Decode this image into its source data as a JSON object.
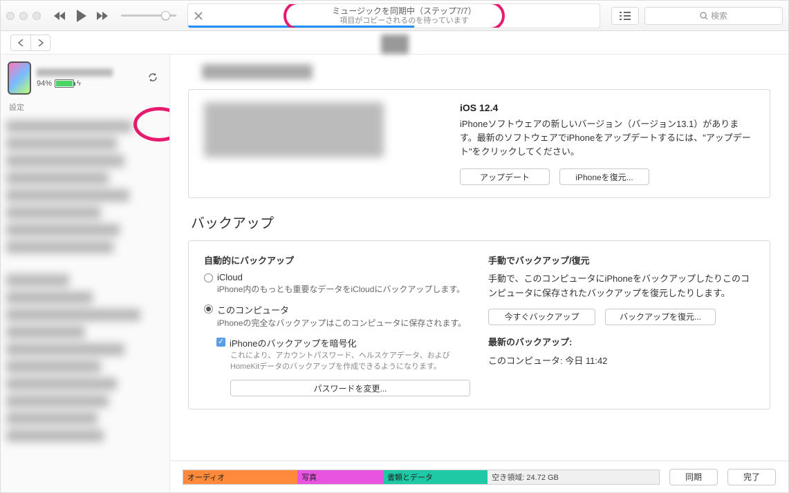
{
  "titlebar": {
    "status_line1": "ミュージックを同期中（ステップ7/7）",
    "status_line2": "項目がコピーされるのを待っています",
    "search_placeholder": "検索"
  },
  "sidebar": {
    "battery_pct": "94%",
    "settings_header": "設定"
  },
  "ios": {
    "heading": "iOS 12.4",
    "body": "iPhoneソフトウェアの新しいバージョン（バージョン13.1）があります。最新のソフトウェアでiPhoneをアップデートするには、\"アップデート\"をクリックしてください。",
    "update_btn": "アップデート",
    "restore_btn": "iPhoneを復元..."
  },
  "backup": {
    "section_title": "バックアップ",
    "auto_hdr": "自動的にバックアップ",
    "opt_icloud": "iCloud",
    "opt_icloud_desc": "iPhone内のもっとも重要なデータをiCloudにバックアップします。",
    "opt_computer": "このコンピュータ",
    "opt_computer_desc": "iPhoneの完全なバックアップはこのコンピュータに保存されます。",
    "encrypt_label": "iPhoneのバックアップを暗号化",
    "encrypt_desc": "これにより、アカウントパスワード、ヘルスケアデータ、およびHomeKitデータのバックアップを作成できるようになります。",
    "change_pw_btn": "パスワードを変更...",
    "manual_hdr": "手動でバックアップ/復元",
    "manual_desc": "手動で、このコンピュータにiPhoneをバックアップしたりこのコンピュータに保存されたバックアップを復元したりします。",
    "backup_now_btn": "今すぐバックアップ",
    "restore_backup_btn": "バックアップを復元...",
    "last_hdr": "最新のバックアップ:",
    "last_val": "このコンピュータ: 今日 11:42"
  },
  "storage": {
    "audio": "オーディオ",
    "photos": "写真",
    "docs": "書類とデータ",
    "free": "空き領域: 24.72 GB"
  },
  "bottom": {
    "sync_btn": "同期",
    "done_btn": "完了"
  }
}
